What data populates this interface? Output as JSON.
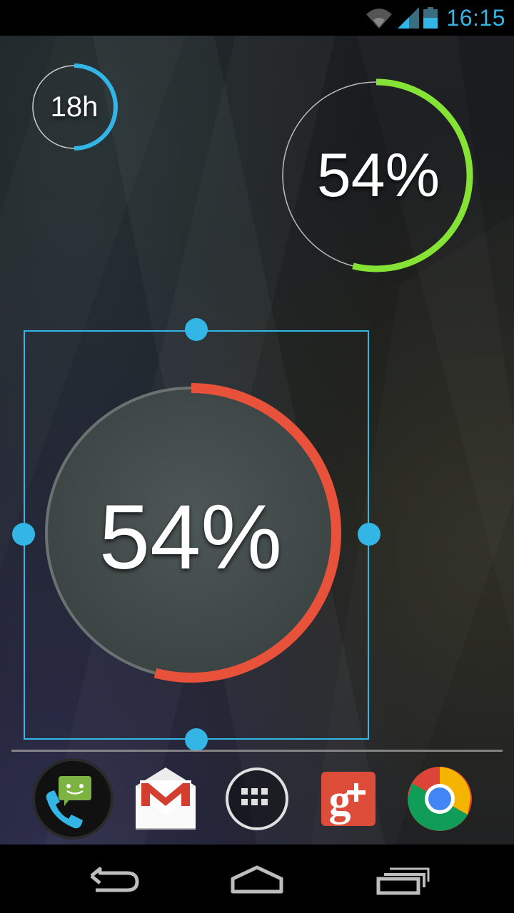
{
  "status_bar": {
    "time": "16:15",
    "icons": [
      "wifi-icon",
      "signal-icon",
      "battery-icon"
    ],
    "accent_color": "#33b5e5"
  },
  "widgets": {
    "small_ring": {
      "label": "18h",
      "progress_fraction": 0.5,
      "color": "#33b5e5"
    },
    "green_ring": {
      "label": "54%",
      "value_percent": 54,
      "color": "#84e334"
    },
    "red_ring": {
      "label": "54%",
      "value_percent": 54,
      "color": "#e8523a",
      "selected_for_resize": true
    }
  },
  "dock": {
    "apps": [
      {
        "name": "Phone and Messaging",
        "icon": "phone-sms-icon"
      },
      {
        "name": "Gmail",
        "icon": "gmail-icon"
      },
      {
        "name": "All Apps",
        "icon": "app-drawer-icon"
      },
      {
        "name": "Google+",
        "icon": "google-plus-icon"
      },
      {
        "name": "Chrome",
        "icon": "chrome-icon"
      }
    ]
  },
  "nav_bar": {
    "buttons": [
      "back-icon",
      "home-icon",
      "recents-icon"
    ]
  },
  "colors": {
    "resize_frame": "#33b5e5",
    "gplus_red": "#dd4b39"
  }
}
